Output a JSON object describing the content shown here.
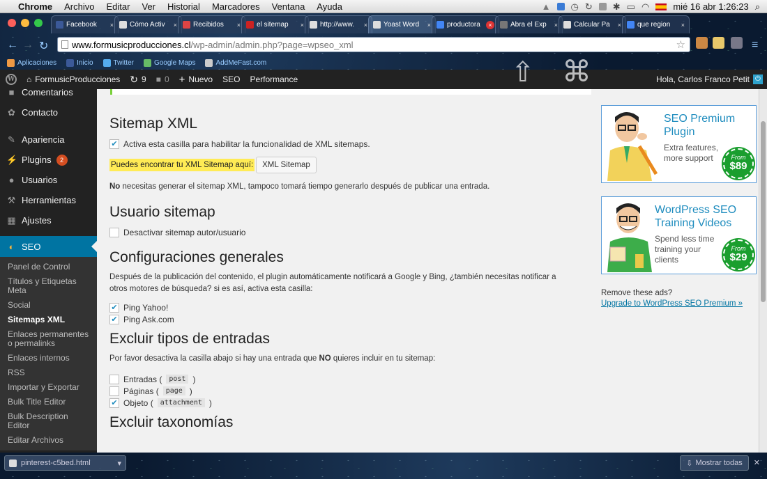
{
  "menubar": {
    "app": "Chrome",
    "items": [
      "Archivo",
      "Editar",
      "Ver",
      "Historial",
      "Marcadores",
      "Ventana",
      "Ayuda"
    ],
    "clock": "mié 16 abr  1:26:23"
  },
  "tabs": [
    {
      "label": "Facebook",
      "color": "#3b5998"
    },
    {
      "label": "Cómo Activ",
      "color": "#ddd"
    },
    {
      "label": "Recibidos",
      "color": "#d44"
    },
    {
      "label": "el sitemap",
      "color": "#c22"
    },
    {
      "label": "http://www.",
      "color": "#ddd"
    },
    {
      "label": "Yoast Word",
      "color": "#ddd",
      "active": true
    },
    {
      "label": "productora",
      "color": "#4285f4",
      "close": "x"
    },
    {
      "label": "Abra el Exp",
      "color": "#777"
    },
    {
      "label": "Calcular Pa",
      "color": "#ddd"
    },
    {
      "label": "que region",
      "color": "#4285f4"
    }
  ],
  "address": {
    "host": "www.formusicproducciones.cl",
    "path": "/wp-admin/admin.php?page=wpseo_xml"
  },
  "bookmarks": [
    "Aplicaciones",
    "Inicio",
    "Twitter",
    "Google Maps",
    "AddMeFast.com"
  ],
  "adminbar": {
    "site": "FormusicProducciones",
    "updates": "9",
    "comments": "0",
    "new": "Nuevo",
    "seo": "SEO",
    "performance": "Performance",
    "greeting": "Hola, Carlos Franco Petit"
  },
  "sidebar": {
    "items": [
      {
        "label": "Comentarios",
        "icon": "comment-icon"
      },
      {
        "label": "Contacto",
        "icon": "gear-icon"
      },
      {
        "label": "Apariencia",
        "icon": "brush-icon"
      },
      {
        "label": "Plugins",
        "icon": "plug-icon",
        "badge": "2"
      },
      {
        "label": "Usuarios",
        "icon": "user-icon"
      },
      {
        "label": "Herramientas",
        "icon": "wrench-icon"
      },
      {
        "label": "Ajustes",
        "icon": "settings-icon"
      },
      {
        "label": "SEO",
        "icon": "seo-icon"
      }
    ],
    "submenu": [
      "Panel de Control",
      "Títulos y Etiquetas Meta",
      "Social",
      "Sitemaps XML",
      "Enlaces permanentes o permalinks",
      "Enlaces internos",
      "RSS",
      "Importar y Exportar",
      "Bulk Title Editor",
      "Bulk Description Editor",
      "Editar Archivos"
    ]
  },
  "sections": {
    "sitemap": {
      "title": "Sitemap XML",
      "enable": "Activa esta casilla para habilitar la funcionalidad de XML sitemaps.",
      "find": "Puedes encontrar tu XML Sitemap aquí:",
      "button": "XML Sitemap",
      "note_bold": "No",
      "note": " necesitas generar el sitemap XML, tampoco tomará tiempo generarlo después de publicar una entrada."
    },
    "user": {
      "title": "Usuario sitemap",
      "disable": "Desactivar sitemap autor/usuario"
    },
    "general": {
      "title": "Configuraciones generales",
      "desc": "Después de la publicación del contenido, el plugin automáticamente notificará a Google y Bing, ¿también necesitas notificar a otros motores de búsqueda? si es así, activa esta casilla:",
      "ping1": "Ping Yahoo!",
      "ping2": "Ping Ask.com"
    },
    "exclude": {
      "title": "Excluir tipos de entradas",
      "desc_a": "Por favor desactiva la casilla abajo si hay una entrada que ",
      "desc_bold": "NO",
      "desc_b": " quieres incluir en tu sitemap:",
      "items": [
        {
          "label": "Entradas (",
          "code": "post",
          "end": ")",
          "checked": false
        },
        {
          "label": "Páginas (",
          "code": "page",
          "end": ")",
          "checked": false
        },
        {
          "label": "Objeto (",
          "code": "attachment",
          "end": ")",
          "checked": true
        }
      ]
    },
    "tax": {
      "title": "Excluir taxonomías"
    }
  },
  "ads": {
    "premium": {
      "title": "SEO Premium Plugin",
      "sub": "Extra features, more support",
      "from": "From",
      "price": "$89"
    },
    "training": {
      "title": "WordPress SEO Training Videos",
      "sub": "Spend less time training your clients",
      "from": "From",
      "price": "$29"
    },
    "remove": "Remove these ads?",
    "upgrade": "Upgrade to WordPress SEO Premium »"
  },
  "downloads": {
    "file": "pinterest-c5bed.html",
    "showall": "Mostrar todas"
  }
}
